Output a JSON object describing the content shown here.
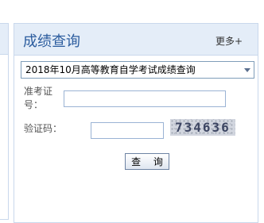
{
  "panel": {
    "title": "成绩查询",
    "more_label": "更多+"
  },
  "exam_select": {
    "selected": "2018年10月高等教育自学考试成绩查询"
  },
  "form": {
    "ticket_label": "准考证号：",
    "ticket_value": "",
    "captcha_label": "验证码：",
    "captcha_value": "",
    "captcha_image_text": "734636",
    "submit_label": "查 询"
  },
  "icons": {
    "select_arrow": "chevron-down-icon"
  }
}
